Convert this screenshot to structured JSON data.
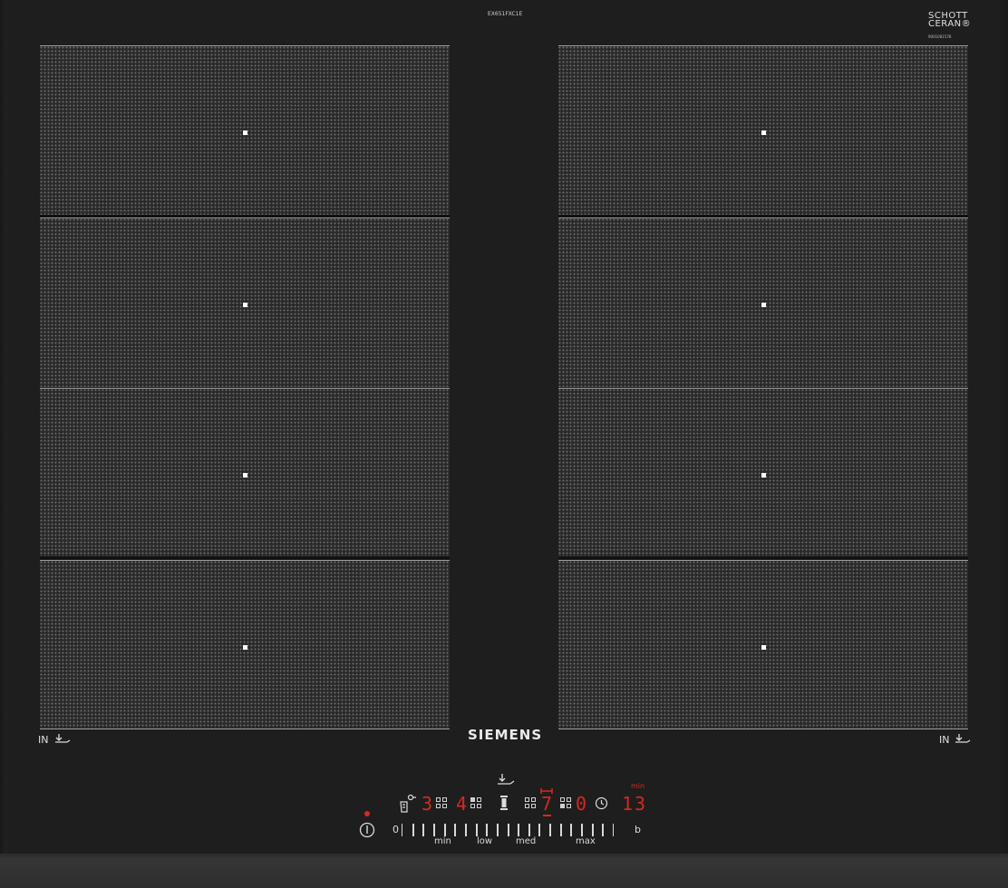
{
  "header": {
    "model": "EX651FXC1E",
    "glass_brand_line1": "SCHOTT",
    "glass_brand_line2": "CERAN®",
    "serial": "9001081578"
  },
  "brand": "SIEMENS",
  "zones": {
    "left": [
      "zone-left-1",
      "zone-left-2",
      "zone-left-3",
      "zone-left-4"
    ],
    "right": [
      "zone-right-1",
      "zone-right-2",
      "zone-right-3",
      "zone-right-4"
    ]
  },
  "side_labels": {
    "left": "IN",
    "right": "IN"
  },
  "control_panel": {
    "zone_digit_1": "3",
    "zone_digit_2": "4",
    "zone_digit_3": "7",
    "zone_digit_4": "0",
    "timer_value": "13",
    "timer_unit": "min",
    "slider": {
      "start_label": "0",
      "end_label": "b",
      "labels": [
        "min",
        "low",
        "med",
        "max"
      ]
    }
  },
  "colors": {
    "display_red": "#d8281e",
    "glass": "#1e1e1e",
    "zone_pattern": "#6b6b6b"
  }
}
